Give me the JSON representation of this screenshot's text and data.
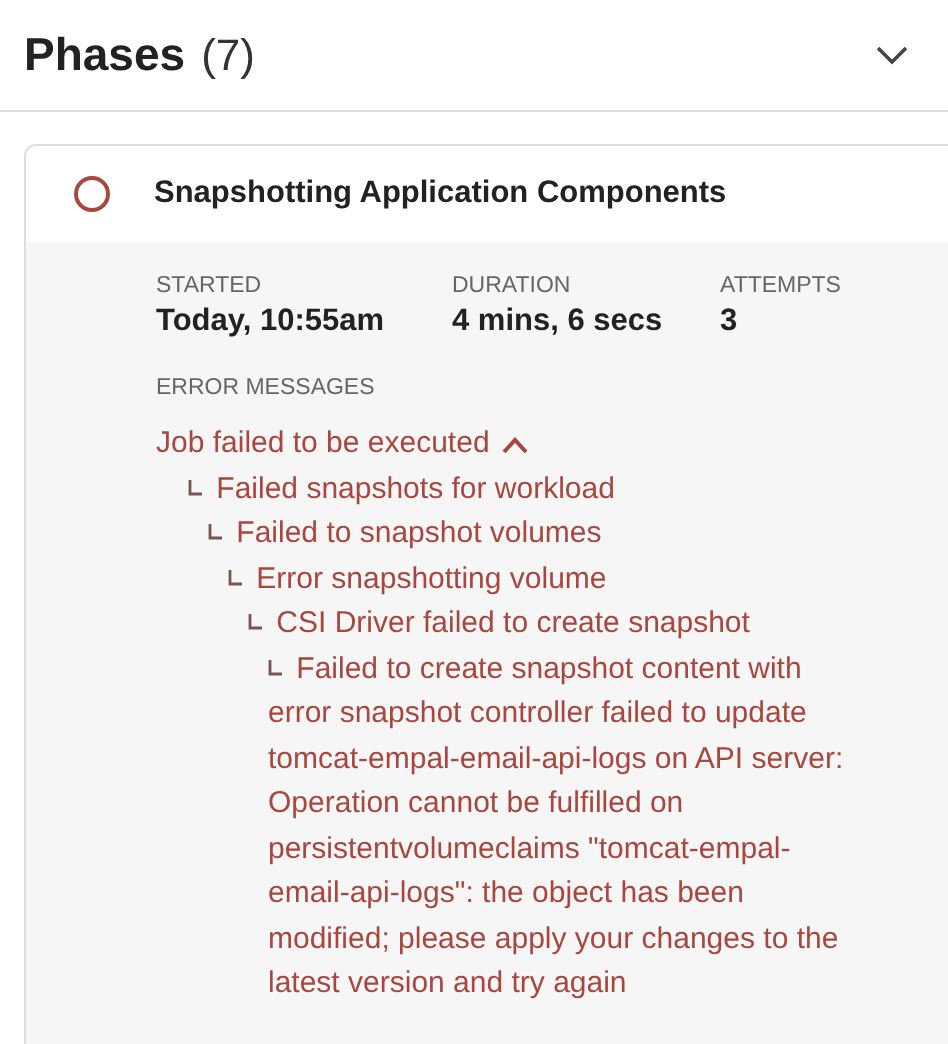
{
  "section": {
    "title": "Phases",
    "count": "(7)",
    "expanded": true
  },
  "phase": {
    "title": "Snapshotting Application Components",
    "stats": [
      {
        "label": "STARTED",
        "value": "Today, 10:55am"
      },
      {
        "label": "DURATION",
        "value": "4 mins, 6 secs"
      },
      {
        "label": "ATTEMPTS",
        "value": "3"
      }
    ],
    "errors_label": "ERROR MESSAGES",
    "error": {
      "text": "Job failed to be executed",
      "expanded": true,
      "children": [
        {
          "text": "Failed snapshots for workload",
          "children": [
            {
              "text": "Failed to snapshot volumes",
              "children": [
                {
                  "text": "Error snapshotting volume",
                  "children": [
                    {
                      "text": "CSI Driver failed to create snapshot",
                      "children": [
                        {
                          "text": "Failed to create snapshot content with error snapshot controller failed to update tomcat-empal-email-api-logs on API server: Operation cannot be fulfilled on persistentvolumeclaims \"tomcat-empal-email-api-logs\": the object has been modified; please apply your changes to the latest version and try again"
                        }
                      ]
                    }
                  ]
                }
              ]
            }
          ]
        }
      ]
    }
  }
}
